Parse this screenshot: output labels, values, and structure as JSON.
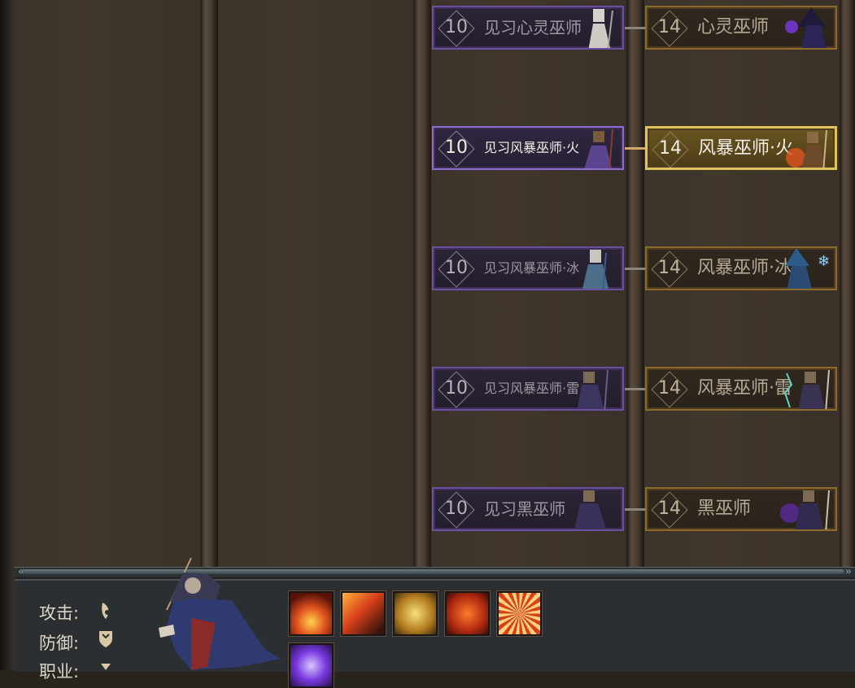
{
  "class_tree": {
    "apprentices": [
      {
        "level": "10",
        "name": "见习心灵巫师",
        "active": false,
        "small": false
      },
      {
        "level": "10",
        "name": "见习风暴巫师·火",
        "active": true,
        "small": true
      },
      {
        "level": "10",
        "name": "见习风暴巫师·冰",
        "active": false,
        "small": true
      },
      {
        "level": "10",
        "name": "见习风暴巫师·雷",
        "active": false,
        "small": true
      },
      {
        "level": "10",
        "name": "见习黑巫师",
        "active": false,
        "small": false
      }
    ],
    "masters": [
      {
        "level": "14",
        "name": "心灵巫师",
        "active": false
      },
      {
        "level": "14",
        "name": "风暴巫师·火",
        "active": true
      },
      {
        "level": "14",
        "name": "风暴巫师·冰",
        "active": false
      },
      {
        "level": "14",
        "name": "风暴巫师·雷",
        "active": false
      },
      {
        "level": "14",
        "name": "黑巫师",
        "active": false
      }
    ]
  },
  "info_panel": {
    "attack_label": "攻击:",
    "defense_label": "防御:",
    "job_label": "职业:",
    "skill_icons": [
      "fire-burst-icon",
      "fire-meteor-icon",
      "heal-figure-icon",
      "fire-mystery-icon",
      "fire-ring-icon",
      "arcane-orb-icon"
    ]
  },
  "colors": {
    "apprentice_border": "#6c4fa0",
    "master_border": "#8c6a2c",
    "active_gold": "#e0c35a"
  }
}
